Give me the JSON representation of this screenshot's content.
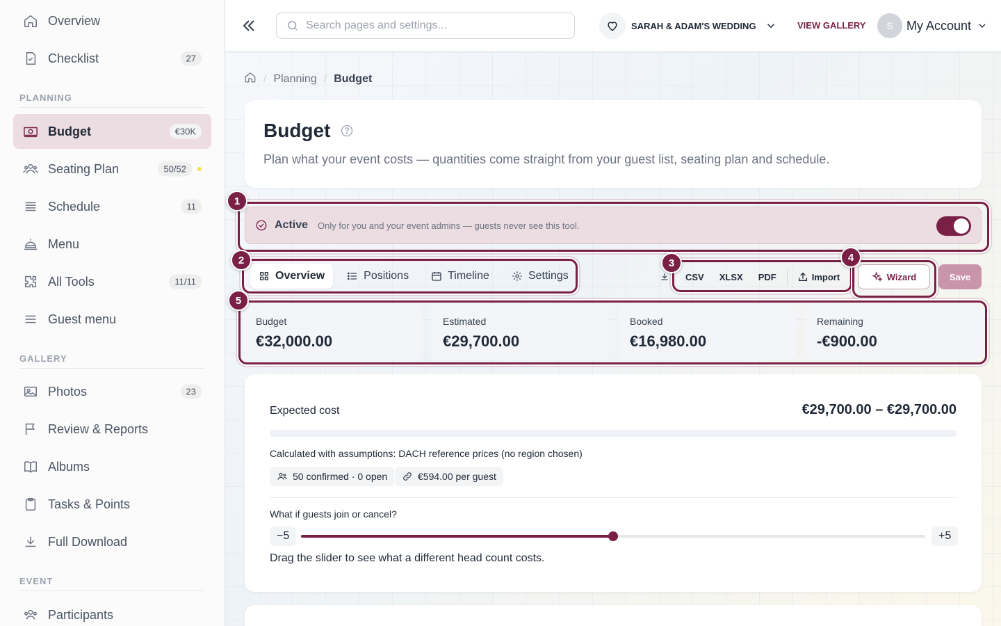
{
  "sidebar": {
    "overview": "Overview",
    "checklist": {
      "label": "Checklist",
      "badge": "27"
    },
    "planning_label": "PLANNING",
    "budget": {
      "label": "Budget",
      "badge": "€30K"
    },
    "seating": {
      "label": "Seating Plan",
      "badge": "50/52"
    },
    "schedule": {
      "label": "Schedule",
      "badge": "11"
    },
    "menu": "Menu",
    "all_tools": {
      "label": "All Tools",
      "badge": "11/11"
    },
    "guest_menu": "Guest menu",
    "gallery_label": "GALLERY",
    "photos": {
      "label": "Photos",
      "badge": "23"
    },
    "review": "Review & Reports",
    "albums": "Albums",
    "tasks": "Tasks & Points",
    "download": "Full Download",
    "event_label": "EVENT",
    "participants": "Participants"
  },
  "topbar": {
    "search_placeholder": "Search pages and settings...",
    "event_name": "SARAH & ADAM'S WEDDING",
    "view_gallery": "VIEW GALLERY",
    "avatar_initial": "S",
    "account": "My Account"
  },
  "breadcrumb": {
    "planning": "Planning",
    "current": "Budget"
  },
  "header": {
    "title": "Budget",
    "subtitle": "Plan what your event costs — quantities come straight from your guest list, seating plan and schedule."
  },
  "active_bar": {
    "title": "Active",
    "subtitle": "Only for you and your event admins — guests never see this tool."
  },
  "tabs": {
    "overview": "Overview",
    "positions": "Positions",
    "timeline": "Timeline",
    "settings": "Settings"
  },
  "export": {
    "csv": "CSV",
    "xlsx": "XLSX",
    "pdf": "PDF",
    "import": "Import"
  },
  "actions": {
    "wizard": "Wizard",
    "save": "Save"
  },
  "kpis": {
    "budget": {
      "label": "Budget",
      "value": "€32,000.00"
    },
    "estimated": {
      "label": "Estimated",
      "value": "€29,700.00"
    },
    "booked": {
      "label": "Booked",
      "value": "€16,980.00"
    },
    "remaining": {
      "label": "Remaining",
      "value": "-€900.00"
    }
  },
  "cost": {
    "title": "Expected cost",
    "range": "€29,700.00 – €29,700.00",
    "assumptions": "Calculated with assumptions: DACH reference prices (no region chosen)",
    "confirmed_chip": "50 confirmed · 0 open",
    "per_guest_chip": "€594.00 per guest",
    "what_if": "What if guests join or cancel?",
    "min_label": "−5",
    "max_label": "+5",
    "slider_fraction": 0.5,
    "hint": "Drag the slider to see what a different head count costs."
  },
  "annotations": {
    "n1": "1",
    "n2": "2",
    "n3": "3",
    "n4": "4",
    "n5": "5"
  },
  "colors": {
    "accent": "#7a1f45",
    "active_bg": "#ecdde2",
    "save_disabled": "#c995ab",
    "seating_dot": "#f5e04a"
  }
}
